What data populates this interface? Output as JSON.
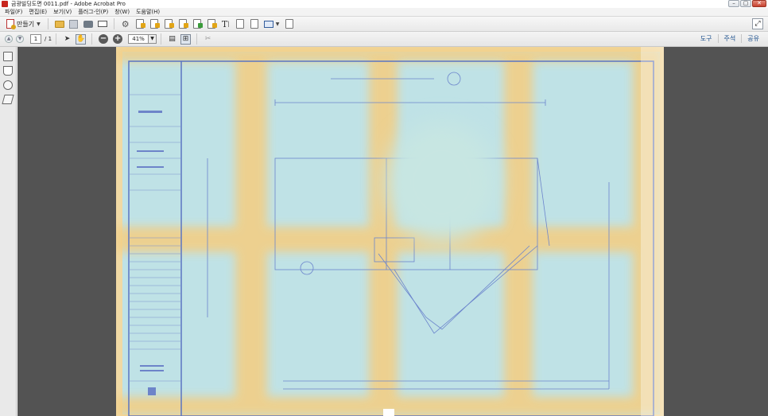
{
  "window": {
    "title": "금광빌딩도면 0011.pdf - Adobe Acrobat Pro",
    "controls": [
      "minimize",
      "maximize",
      "close"
    ]
  },
  "menu": [
    "파일(F)",
    "편집(E)",
    "보기(V)",
    "플러그-인(P)",
    "창(W)",
    "도움말(H)"
  ],
  "toolbar": {
    "create_label": "만들기",
    "icons": [
      "open-icon",
      "save-icon",
      "print-icon",
      "email-icon",
      "settings-icon",
      "create-pdf-icon",
      "combine-icon",
      "export-icon",
      "comment-icon",
      "sign-icon",
      "edit-text-icon",
      "form-icon",
      "attach-icon",
      "dropbox-icon",
      "page-icon"
    ]
  },
  "navigation": {
    "page_current": "1",
    "page_total": "/ 1",
    "zoom": "41%"
  },
  "right_panel_links": [
    "도구",
    "주석",
    "공유"
  ],
  "document": {
    "description_hidden": true
  }
}
